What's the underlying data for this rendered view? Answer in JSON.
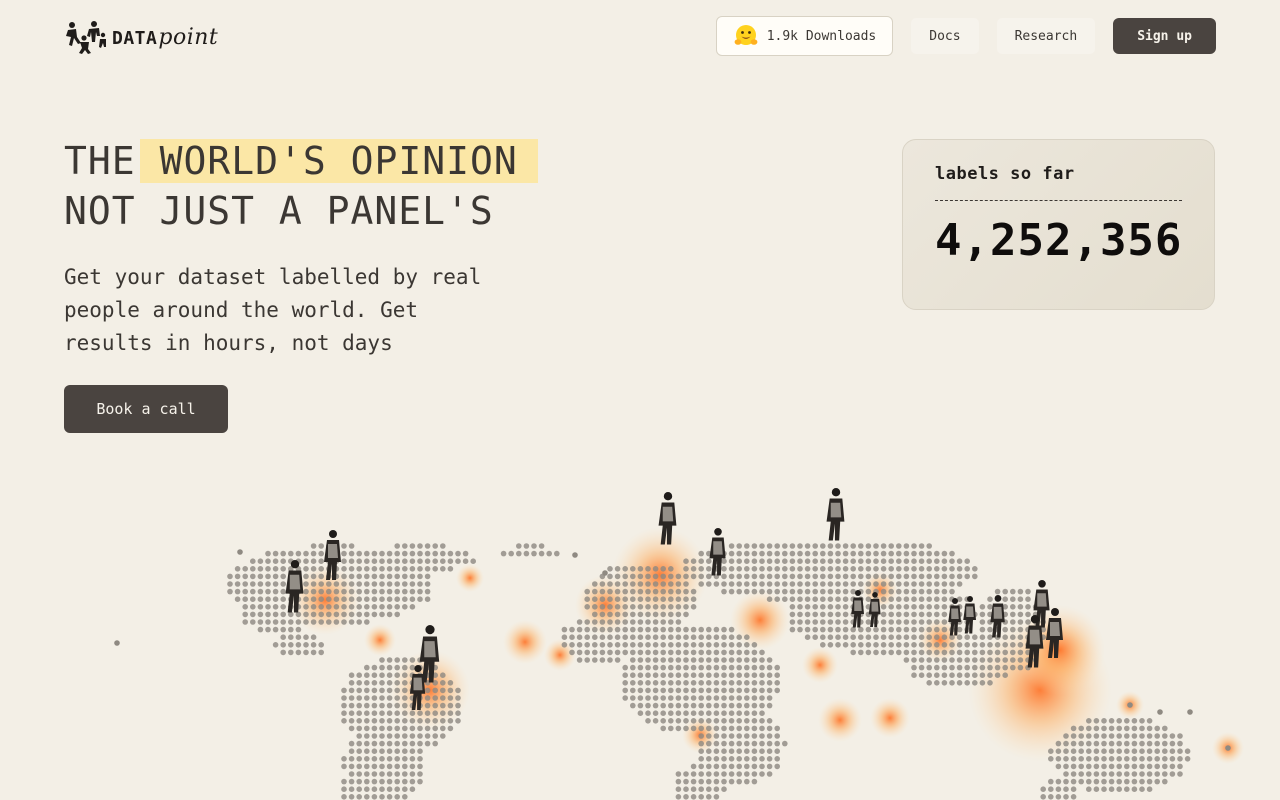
{
  "brand": {
    "name_a": "DATA",
    "name_b": "point"
  },
  "nav": {
    "downloads_label": "1.9k Downloads",
    "docs_label": "Docs",
    "research_label": "Research",
    "signup_label": "Sign up"
  },
  "hero": {
    "title_line1_plain": "THE",
    "title_line1_highlight": "WORLD'S OPINION",
    "title_line2": "NOT JUST A PANEL'S",
    "subtitle": "Get your dataset labelled by real people around the world. Get results in hours, not days",
    "cta_label": "Book a call"
  },
  "counter": {
    "label": "labels so far",
    "value": "4,252,356"
  },
  "colors": {
    "background": "#f3efe6",
    "dark_button": "#4a4440",
    "highlight": "#fbe7a6",
    "heat": "#ff7a2e",
    "map_dot": "#8f8a82"
  },
  "icons": {
    "logo": "people-cluster-logo-icon",
    "downloads": "hugging-face-emoji-icon",
    "map": "dotted-world-map-heatmap"
  }
}
